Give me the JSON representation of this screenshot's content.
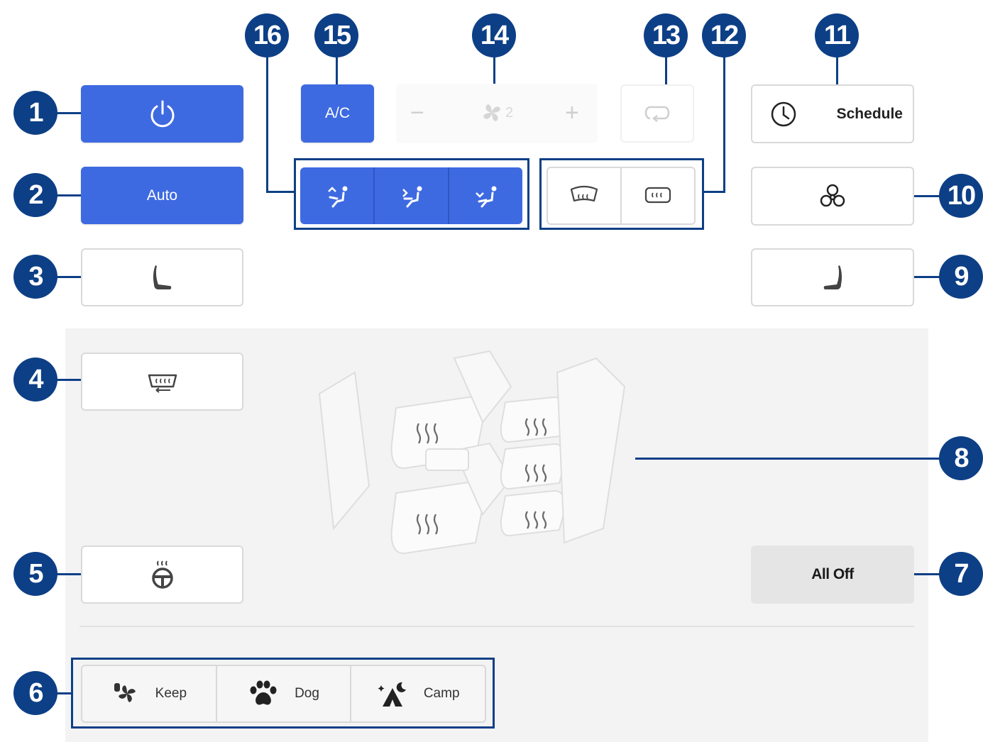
{
  "callouts": [
    "1",
    "2",
    "3",
    "4",
    "5",
    "6",
    "7",
    "8",
    "9",
    "10",
    "11",
    "12",
    "13",
    "14",
    "15",
    "16"
  ],
  "buttons": {
    "power_icon": "power-icon",
    "auto_label": "Auto",
    "ac_label": "A/C",
    "schedule_label": "Schedule",
    "all_off_label": "All Off"
  },
  "fan": {
    "minus": "−",
    "plus": "+",
    "level": "2"
  },
  "modes": [
    {
      "label": "Keep",
      "icon": "fan-icon"
    },
    {
      "label": "Dog",
      "icon": "paw-icon"
    },
    {
      "label": "Camp",
      "icon": "tent-icon"
    }
  ],
  "colors": {
    "accent": "#3e6ae1",
    "callout": "#0d3f86",
    "panel": "#f3f3f3"
  }
}
